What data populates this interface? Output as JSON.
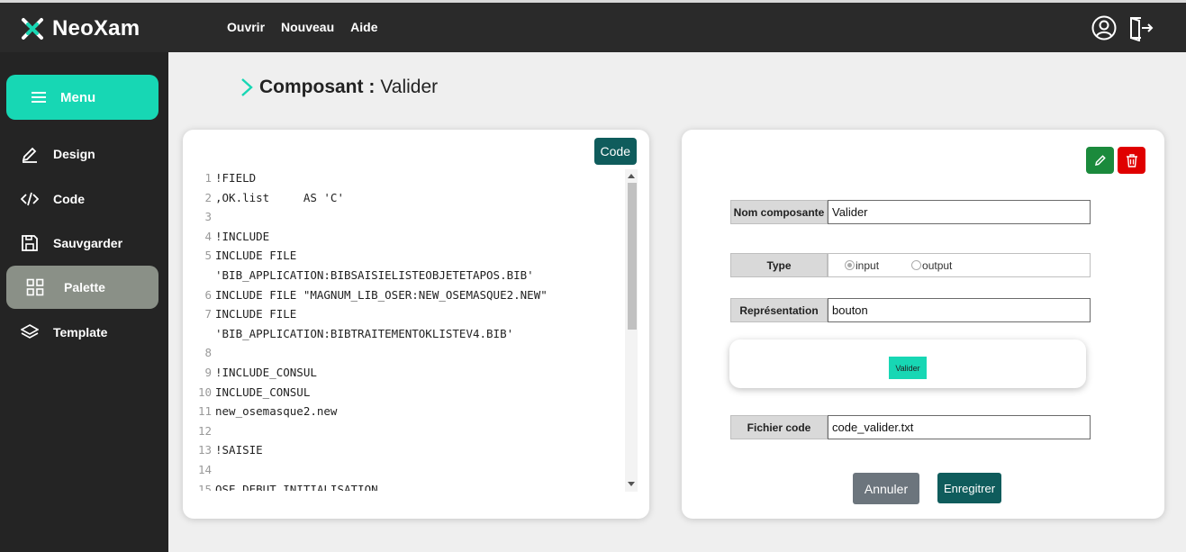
{
  "app": {
    "brand": "NeoXam"
  },
  "topnav": [
    {
      "label": "Ouvrir"
    },
    {
      "label": "Nouveau"
    },
    {
      "label": "Aide"
    }
  ],
  "sidebar": {
    "menu_label": "Menu",
    "items": [
      {
        "label": "Design",
        "icon": "pencil-icon"
      },
      {
        "label": "Code",
        "icon": "code-icon"
      },
      {
        "label": "Sauvgarder",
        "icon": "save-icon"
      },
      {
        "label": "Palette",
        "icon": "grid-icon",
        "active": true
      },
      {
        "label": "Template",
        "icon": "layers-icon"
      }
    ]
  },
  "heading": {
    "label": "Composant :",
    "name": "Valider"
  },
  "editor": {
    "button_label": "Code",
    "lines": [
      {
        "n": "1",
        "text": "!FIELD"
      },
      {
        "n": "2",
        "text": ",OK.list     AS 'C'"
      },
      {
        "n": "3",
        "text": ""
      },
      {
        "n": "4",
        "text": "!INCLUDE"
      },
      {
        "n": "5",
        "text": "INCLUDE FILE"
      },
      {
        "n": "",
        "text": "'BIB_APPLICATION:BIBSAISIELISTEOBJETETAPOS.BIB'"
      },
      {
        "n": "6",
        "text": "INCLUDE FILE \"MAGNUM_LIB_OSER:NEW_OSEMASQUE2.NEW\""
      },
      {
        "n": "7",
        "text": "INCLUDE FILE"
      },
      {
        "n": "",
        "text": "'BIB_APPLICATION:BIBTRAITEMENTOKLISTEV4.BIB'"
      },
      {
        "n": "8",
        "text": ""
      },
      {
        "n": "9",
        "text": "!INCLUDE_CONSUL"
      },
      {
        "n": "10",
        "text": "INCLUDE_CONSUL"
      },
      {
        "n": "11",
        "text": "new_osemasque2.new"
      },
      {
        "n": "12",
        "text": ""
      },
      {
        "n": "13",
        "text": "!SAISIE"
      },
      {
        "n": "14",
        "text": ""
      },
      {
        "n": "15",
        "text": "OSE_DEBUT_INITIALISATION"
      }
    ]
  },
  "form": {
    "nom_label": "Nom composante",
    "nom_value": "Valider",
    "type_label": "Type",
    "type_options": [
      {
        "label": "input",
        "selected": true
      },
      {
        "label": "output",
        "selected": false
      }
    ],
    "repr_label": "Représentation",
    "repr_value": "bouton",
    "preview_label": "Valider",
    "fichier_label": "Fichier code",
    "fichier_value": "code_valider.txt",
    "cancel_label": "Annuler",
    "save_label": "Enregitrer"
  },
  "colors": {
    "accent": "#17d7b4",
    "dark_teal": "#0f5c5c",
    "edit_green": "#1b8a3c",
    "delete_red": "#e00000",
    "sidebar_bg": "#242424"
  }
}
